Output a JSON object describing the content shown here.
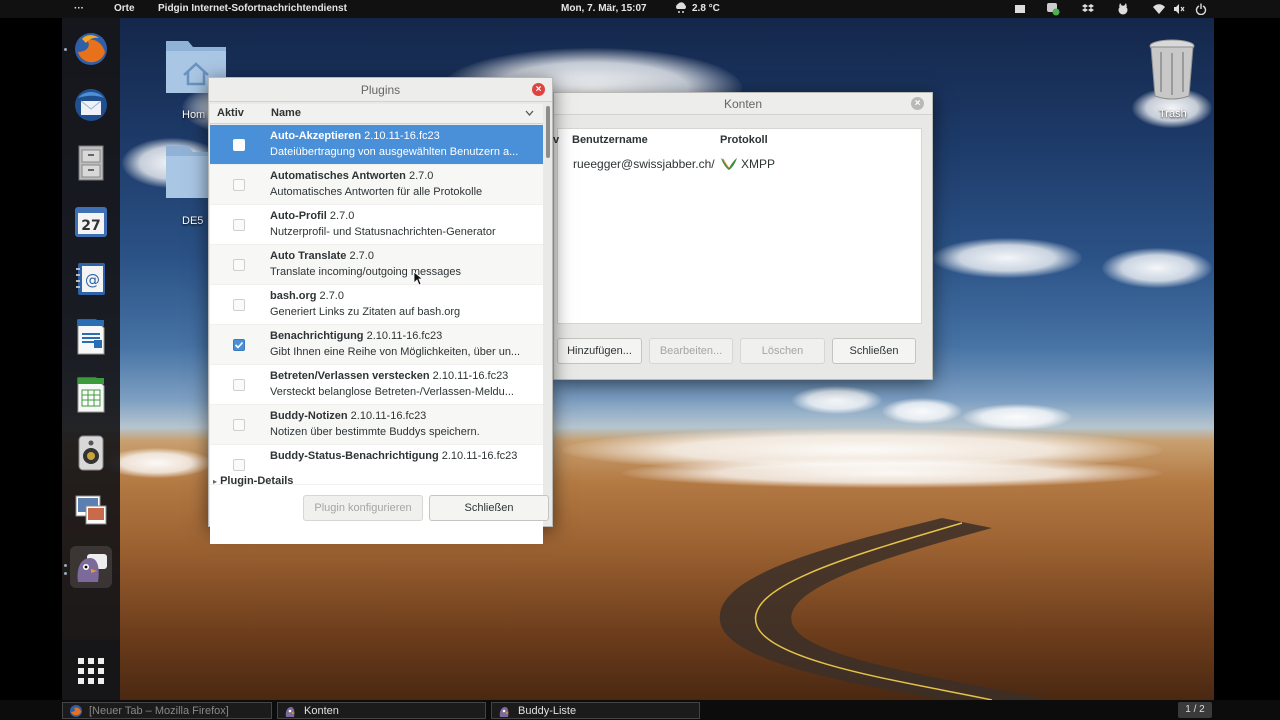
{
  "topbar": {
    "menu_dots": "···",
    "activities": "Orte",
    "app_title": "Pidgin Internet-Sofortnachrichtendienst",
    "datetime": "Mon, 7. Mär, 15:07",
    "weather": "2.8 °C",
    "weather_icon": "cloud-snow-icon",
    "tray_icons": [
      "window-icon",
      "pidgin-status-icon",
      "dropbox-icon",
      "cat-icon",
      "wifi-icon",
      "volume-mute-icon",
      "power-icon"
    ]
  },
  "dock": {
    "items": [
      {
        "name": "firefox",
        "icon": "firefox-icon"
      },
      {
        "name": "thunderbird",
        "icon": "thunderbird-icon"
      },
      {
        "name": "file-cabinet",
        "icon": "file-cabinet-icon"
      },
      {
        "name": "calendar",
        "icon": "calendar-icon",
        "label": "27"
      },
      {
        "name": "contacts",
        "icon": "address-book-icon",
        "label": "@"
      },
      {
        "name": "writer",
        "icon": "writer-icon"
      },
      {
        "name": "calc",
        "icon": "calc-icon"
      },
      {
        "name": "audio",
        "icon": "speaker-icon"
      },
      {
        "name": "images",
        "icon": "image-viewer-icon"
      },
      {
        "name": "pidgin",
        "icon": "pidgin-icon"
      }
    ],
    "apps_grid_icon": "apps-grid-icon"
  },
  "desktop": {
    "icons": [
      {
        "name": "home-folder",
        "label": "Hom"
      },
      {
        "name": "de-folder",
        "label": "DE5"
      },
      {
        "name": "trash",
        "label": "Trash"
      }
    ]
  },
  "konten_window": {
    "title": "Konten",
    "columns": {
      "c0": "v",
      "c1": "Benutzername",
      "c2": "Protokoll"
    },
    "accounts": [
      {
        "username": "rueegger@swissjabber.ch/",
        "protocol": "XMPP",
        "protocol_icon": "xmpp-icon"
      }
    ],
    "buttons": {
      "add": "Hinzufügen...",
      "edit": "Bearbeiten...",
      "delete": "Löschen",
      "close": "Schließen"
    }
  },
  "plugins_window": {
    "title": "Plugins",
    "headers": {
      "active": "Aktiv",
      "name": "Name"
    },
    "plugins": [
      {
        "name": "Auto-Akzeptieren",
        "version": "2.10.11-16.fc23",
        "desc": "Dateiübertragung von ausgewählten Benutzern a...",
        "checked": false,
        "selected": true
      },
      {
        "name": "Automatisches Antworten",
        "version": "2.7.0",
        "desc": "Automatisches Antworten für alle Protokolle",
        "checked": false,
        "selected": false
      },
      {
        "name": "Auto-Profil",
        "version": "2.7.0",
        "desc": "Nutzerprofil- und Statusnachrichten-Generator",
        "checked": false,
        "selected": false
      },
      {
        "name": "Auto Translate",
        "version": "2.7.0",
        "desc": "Translate incoming/outgoing messages",
        "checked": false,
        "selected": false
      },
      {
        "name": "bash.org",
        "version": "2.7.0",
        "desc": "Generiert Links zu Zitaten auf bash.org",
        "checked": false,
        "selected": false
      },
      {
        "name": "Benachrichtigung",
        "version": "2.10.11-16.fc23",
        "desc": "Gibt Ihnen eine Reihe von Möglichkeiten, über un...",
        "checked": true,
        "selected": false
      },
      {
        "name": "Betreten/Verlassen verstecken",
        "version": "2.10.11-16.fc23",
        "desc": "Versteckt belanglose Betreten-/Verlassen-Meldu...",
        "checked": false,
        "selected": false
      },
      {
        "name": "Buddy-Notizen",
        "version": "2.10.11-16.fc23",
        "desc": "Notizen über bestimmte Buddys speichern.",
        "checked": false,
        "selected": false
      },
      {
        "name": "Buddy-Status-Benachrichtigung",
        "version": "2.10.11-16.fc23",
        "desc": "",
        "checked": false,
        "selected": false
      }
    ],
    "details_label": "Plugin-Details",
    "buttons": {
      "configure": "Plugin konfigurieren",
      "close": "Schließen"
    }
  },
  "taskbar": {
    "tasks": [
      {
        "label": "[Neuer Tab – Mozilla Firefox]",
        "icon": "firefox-icon"
      },
      {
        "label": "Konten",
        "icon": "pidgin-icon"
      },
      {
        "label": "Buddy-Liste",
        "icon": "pidgin-icon"
      }
    ],
    "workspace": "1 / 2"
  },
  "colors": {
    "selection": "#4a90d9",
    "close_red": "#e0443e",
    "topbar": "#111111"
  }
}
